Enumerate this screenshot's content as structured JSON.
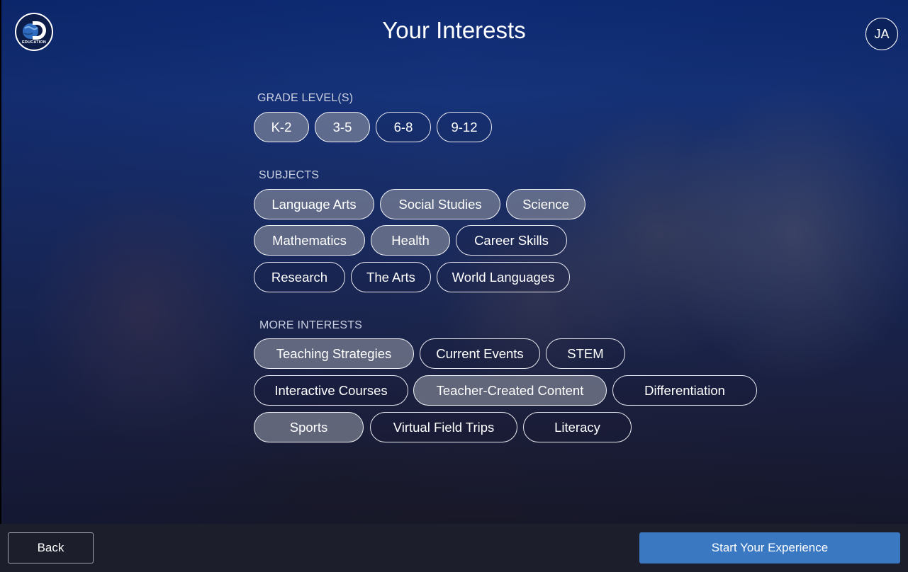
{
  "header": {
    "logo_text": "EDUCATION",
    "title": "Your Interests",
    "avatar_initials": "JA"
  },
  "grade_levels": {
    "label": "GRADE LEVEL(S)",
    "options": [
      {
        "label": "K-2",
        "selected": true
      },
      {
        "label": "3-5",
        "selected": true
      },
      {
        "label": "6-8",
        "selected": false
      },
      {
        "label": "9-12",
        "selected": false
      }
    ]
  },
  "subjects": {
    "label": "SUBJECTS",
    "options": [
      {
        "label": "Language Arts",
        "selected": true
      },
      {
        "label": "Social Studies",
        "selected": true
      },
      {
        "label": "Science",
        "selected": true
      },
      {
        "label": "Mathematics",
        "selected": true
      },
      {
        "label": "Health",
        "selected": true
      },
      {
        "label": "Career Skills",
        "selected": false
      },
      {
        "label": "Research",
        "selected": false
      },
      {
        "label": "The Arts",
        "selected": false
      },
      {
        "label": "World Languages",
        "selected": false
      }
    ]
  },
  "more_interests": {
    "label": "MORE INTERESTS",
    "options": [
      {
        "label": "Teaching Strategies",
        "selected": true
      },
      {
        "label": "Current Events",
        "selected": false
      },
      {
        "label": "STEM",
        "selected": false
      },
      {
        "label": "Interactive Courses",
        "selected": false
      },
      {
        "label": "Teacher-Created Content",
        "selected": true
      },
      {
        "label": "Differentiation",
        "selected": false
      },
      {
        "label": "Sports",
        "selected": true
      },
      {
        "label": "Virtual Field Trips",
        "selected": false
      },
      {
        "label": "Literacy",
        "selected": false
      }
    ]
  },
  "footer": {
    "back_label": "Back",
    "start_label": "Start Your Experience"
  },
  "colors": {
    "accent": "#3b78c2",
    "footer_bg": "#1c1f2b",
    "selected_pill": "#8c91a0"
  }
}
